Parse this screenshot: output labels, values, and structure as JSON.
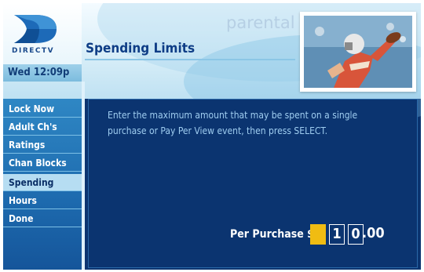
{
  "brand": {
    "logo_text": "DIRECTV"
  },
  "header": {
    "time": "Wed 12:09p",
    "title": "Spending Limits",
    "section": "parental"
  },
  "menu": {
    "items": [
      {
        "label": "Lock Now"
      },
      {
        "label": "Adult Ch's"
      },
      {
        "label": "Ratings"
      },
      {
        "label": "Chan Blocks"
      },
      {
        "label": "Spending",
        "active": true
      },
      {
        "label": "Hours"
      },
      {
        "label": "Done"
      }
    ]
  },
  "main": {
    "instructions": "Enter the maximum amount that may be spent on a single purchase or Pay Per View event, then press SELECT.",
    "per_purchase_label": "Per Purchase $",
    "digits": [
      "",
      "1",
      "0"
    ],
    "cents": ".00"
  },
  "colors": {
    "accent_yellow": "#f0bc12",
    "panel_blue": "#0b3470",
    "sidebar_blue": "#1d6aae",
    "active_item": "#b6ddf2"
  },
  "icons": {
    "logo": "directv-logo-icon",
    "photo": "football-player-photo"
  }
}
